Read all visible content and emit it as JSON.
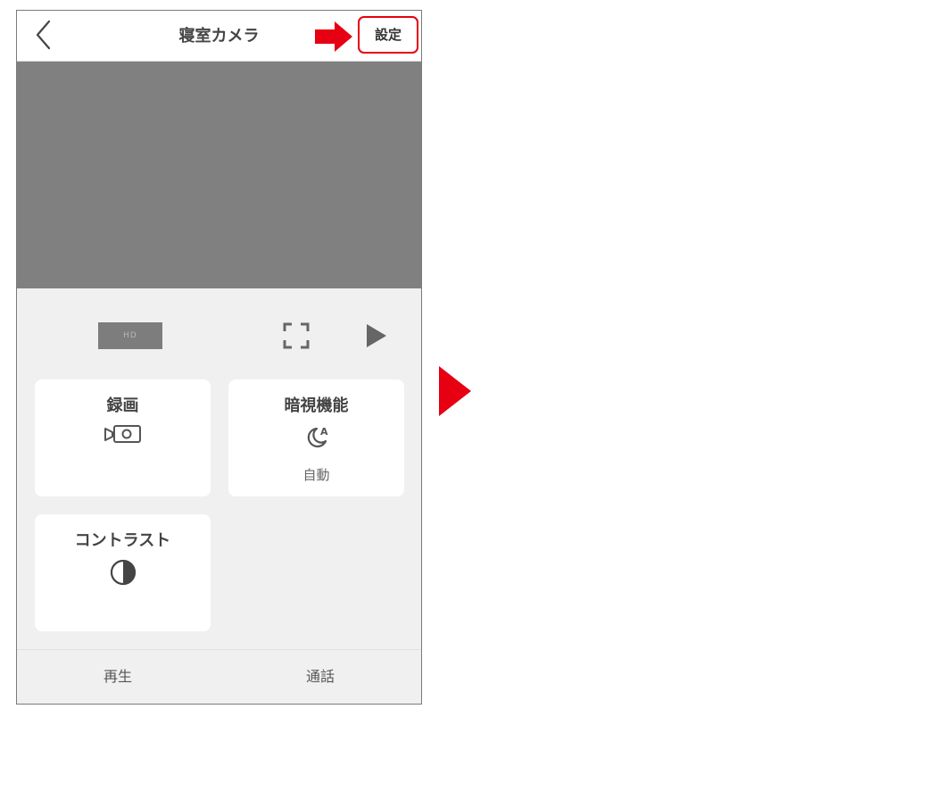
{
  "header": {
    "title": "寝室カメラ",
    "settings_label": "設定"
  },
  "controls": {
    "quality_label": "HD"
  },
  "cards": {
    "record": {
      "label": "録画"
    },
    "night_vision": {
      "label": "暗視機能",
      "value": "自動"
    },
    "contrast": {
      "label": "コントラスト"
    }
  },
  "bottom_tabs": {
    "playback": "再生",
    "call": "通話"
  },
  "colors": {
    "accent_red": "#e60012",
    "video_placeholder": "#808080",
    "panel_bg": "#f0f0f0",
    "icon_gray": "#555555"
  },
  "icons": {
    "back": "chevron-left-icon",
    "fullscreen": "fullscreen-icon",
    "play": "play-icon",
    "record": "video-camera-icon",
    "night_vision": "moon-auto-icon",
    "contrast": "contrast-icon"
  }
}
